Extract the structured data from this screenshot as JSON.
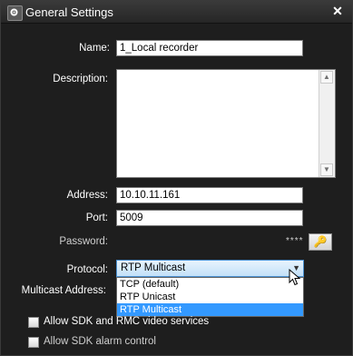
{
  "window": {
    "title": "General Settings",
    "title_icon": "gear-icon",
    "close_icon": "close-icon"
  },
  "form": {
    "name_label": "Name:",
    "name_value": "1_Local recorder",
    "description_label": "Description:",
    "description_value": "",
    "address_label": "Address:",
    "address_value": "10.10.11.161",
    "port_label": "Port:",
    "port_value": "5009",
    "password_label": "Password:",
    "password_mask": "****",
    "password_button_icon": "key-icon",
    "protocol_label": "Protocol:",
    "protocol_selected": "RTP Multicast",
    "protocol_options": [
      "TCP (default)",
      "RTP Unicast",
      "RTP Multicast"
    ],
    "multicast_label": "Multicast Address:",
    "sdk_rmc_label": "Allow SDK and RMC video services",
    "sdk_alarm_label": "Allow SDK alarm control"
  },
  "colors": {
    "background": "#1e1e1e",
    "selection": "#3399ff"
  }
}
